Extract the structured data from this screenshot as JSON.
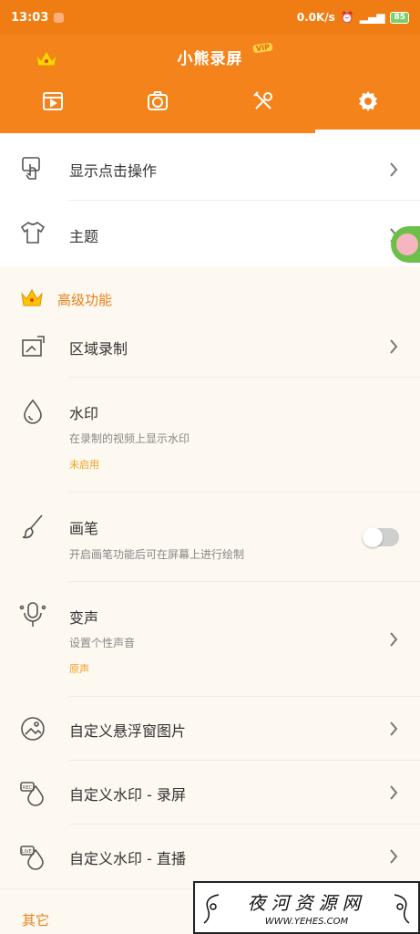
{
  "status_bar": {
    "time": "13:03",
    "net_speed": "0.0K/s",
    "battery": "85"
  },
  "app": {
    "title": "小熊录屏",
    "vip_badge": "VIP"
  },
  "tabs": [
    {
      "icon": "video-icon",
      "active": false
    },
    {
      "icon": "camera-icon",
      "active": false
    },
    {
      "icon": "tools-icon",
      "active": false
    },
    {
      "icon": "settings-icon",
      "active": true
    }
  ],
  "settings": {
    "show_touches": "显示点击操作",
    "theme": "主题"
  },
  "advanced": {
    "header": "高级功能",
    "area_record": "区域录制",
    "watermark": {
      "title": "水印",
      "sub": "在录制的视频上显示水印",
      "status": "未启用"
    },
    "brush": {
      "title": "画笔",
      "sub": "开启画笔功能后可在屏幕上进行绘制",
      "enabled": false
    },
    "voice_change": {
      "title": "变声",
      "sub": "设置个性声音",
      "status": "原声"
    },
    "float_image": "自定义悬浮窗图片",
    "wm_record": "自定义水印 - 录屏",
    "wm_live": "自定义水印 - 直播"
  },
  "other": {
    "header": "其它"
  },
  "watermark_overlay": {
    "main": "夜河资源网",
    "url": "WWW.YEHES.COM"
  },
  "colors": {
    "accent": "#f5831c",
    "section_label": "#e8801a",
    "status_text": "#f0a020"
  }
}
